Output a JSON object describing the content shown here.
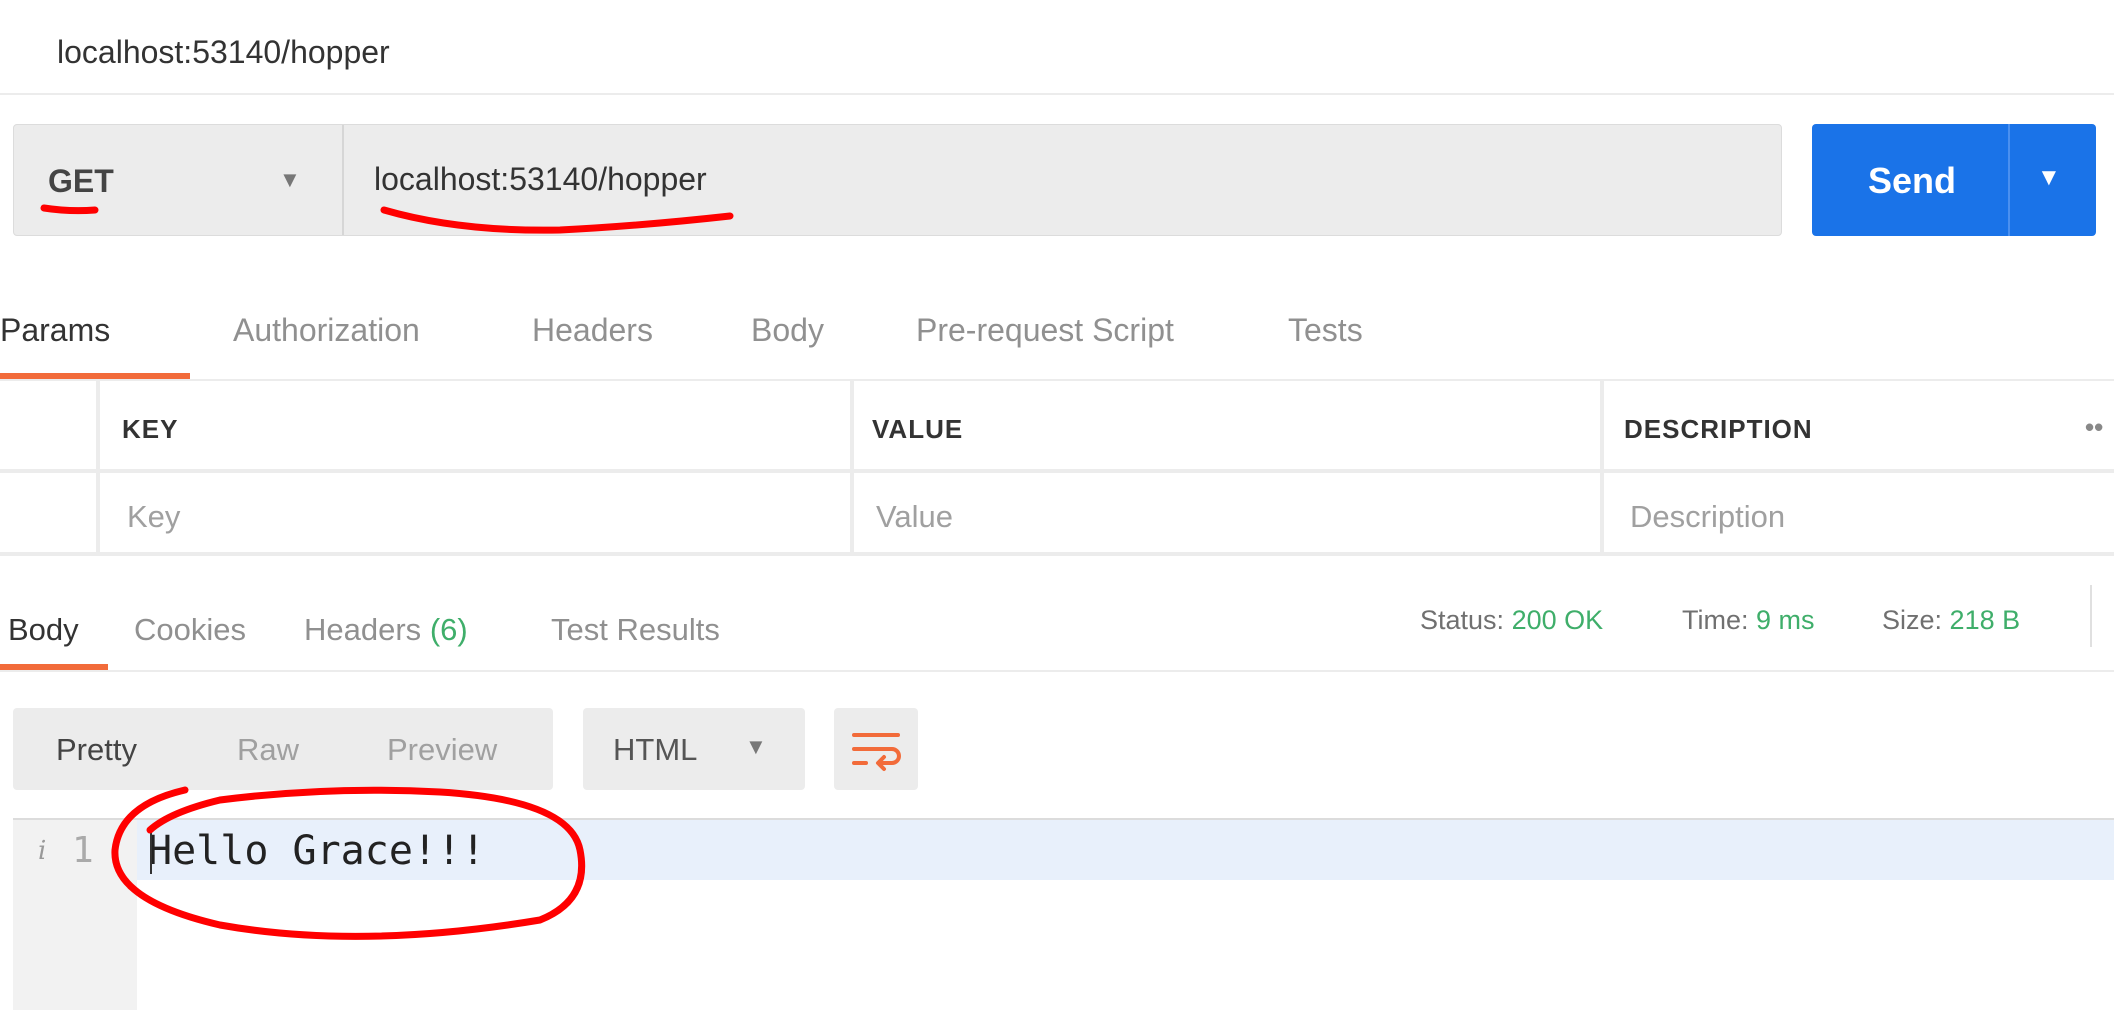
{
  "window": {
    "title": "localhost:53140/hopper"
  },
  "request": {
    "method": "GET",
    "url": "localhost:53140/hopper",
    "send_label": "Send"
  },
  "request_tabs": [
    "Params",
    "Authorization",
    "Headers",
    "Body",
    "Pre-request Script",
    "Tests"
  ],
  "params_table": {
    "headers": {
      "key": "KEY",
      "value": "VALUE",
      "description": "DESCRIPTION",
      "more": "••"
    },
    "row": {
      "key": "Key",
      "value": "Value",
      "description": "Description"
    }
  },
  "response_tabs": {
    "body": "Body",
    "cookies": "Cookies",
    "headers": "Headers",
    "headers_count": "(6)",
    "test_results": "Test Results"
  },
  "status": {
    "status_label": "Status:",
    "status_value": "200 OK",
    "time_label": "Time:",
    "time_value": "9 ms",
    "size_label": "Size:",
    "size_value": "218 B"
  },
  "view_modes": [
    "Pretty",
    "Raw",
    "Preview"
  ],
  "format": "HTML",
  "editor": {
    "info_icon": "i",
    "line_number": "1",
    "content": "Hello Grace!!!"
  },
  "icons": {
    "method_dropdown": "chevron-down-icon",
    "send_dropdown": "chevron-down-icon",
    "format_dropdown": "chevron-down-icon",
    "wrap": "wrap-lines-icon",
    "info": "info-icon"
  },
  "colors": {
    "accent": "#f26b3a",
    "send_button": "#1a73e8",
    "status_value": "#3fae6a",
    "annotation": "#ff0000"
  }
}
